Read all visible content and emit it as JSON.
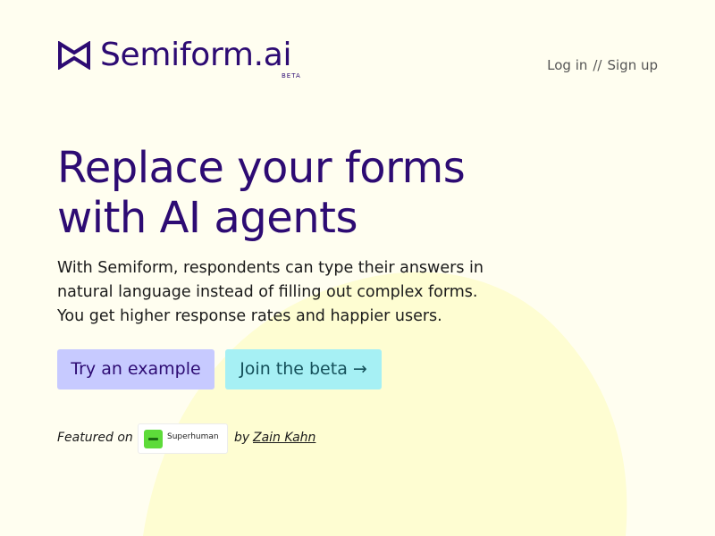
{
  "brand": {
    "name": "Semiform.ai",
    "badge": "BETA",
    "logo_icon": "bowtie-logo-icon",
    "color": "#2D0B73"
  },
  "nav": {
    "login_label": "Log in",
    "separator": "//",
    "signup_label": "Sign up"
  },
  "hero": {
    "title_line1": "Replace your forms",
    "title_line2": "with AI agents",
    "subtitle_line1": "With Semiform, respondents can type their answers in",
    "subtitle_line2": "natural language instead of filling out complex forms.",
    "subtitle_line3": "You get higher response rates and happier users."
  },
  "cta": {
    "example_label": "Try an example",
    "beta_label": "Join the beta →"
  },
  "featured": {
    "label": "Featured on",
    "publication": "Superhuman",
    "publication_icon": "superhuman-logo-icon",
    "by_label": "by",
    "author": "Zain Kahn"
  },
  "colors": {
    "background": "#FFFEF0",
    "blob": "#FEFDD2",
    "example_button": "#C7CAFF",
    "beta_button": "#A6F0F4",
    "superhuman_green": "#5DDB3A"
  }
}
